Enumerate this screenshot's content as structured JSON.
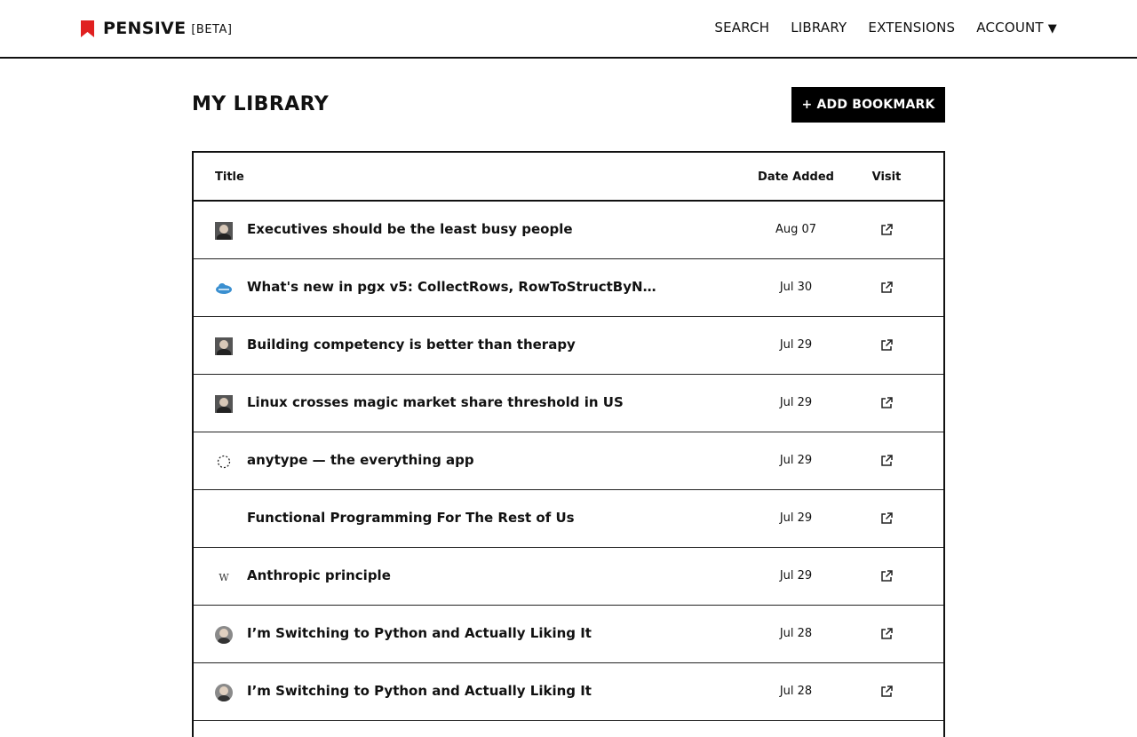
{
  "header": {
    "brand_name": "PENSIVE",
    "brand_tag": "[BETA]",
    "brand_color": "#e02020",
    "nav": [
      {
        "label": "SEARCH"
      },
      {
        "label": "LIBRARY"
      },
      {
        "label": "EXTENSIONS"
      },
      {
        "label": "ACCOUNT",
        "caret": "▼"
      }
    ]
  },
  "main": {
    "title": "MY LIBRARY",
    "add_button_label": "+ ADD BOOKMARK"
  },
  "table": {
    "columns": {
      "title": "Title",
      "date": "Date Added",
      "visit": "Visit"
    },
    "rows": [
      {
        "title": "Executives should be the least busy people",
        "date": "Aug 07",
        "favicon": "photo-icon"
      },
      {
        "title": "What's new in pgx v5: CollectRows, RowToStructByName,...",
        "date": "Jul 30",
        "favicon": "cloud-icon"
      },
      {
        "title": "Building competency is better than therapy",
        "date": "Jul 29",
        "favicon": "photo-icon"
      },
      {
        "title": "Linux crosses magic market share threshold in US",
        "date": "Jul 29",
        "favicon": "photo-icon"
      },
      {
        "title": "anytype — the everything app",
        "date": "Jul 29",
        "favicon": "dotted-circle-icon"
      },
      {
        "title": "Functional Programming For The Rest of Us",
        "date": "Jul 29",
        "favicon": "none"
      },
      {
        "title": "Anthropic principle",
        "date": "Jul 29",
        "favicon": "wikipedia-icon",
        "favicon_text": "W"
      },
      {
        "title": "I’m Switching to Python and Actually Liking It",
        "date": "Jul 28",
        "favicon": "avatar-icon"
      },
      {
        "title": "I’m Switching to Python and Actually Liking It",
        "date": "Jul 28",
        "favicon": "avatar-icon"
      }
    ]
  }
}
